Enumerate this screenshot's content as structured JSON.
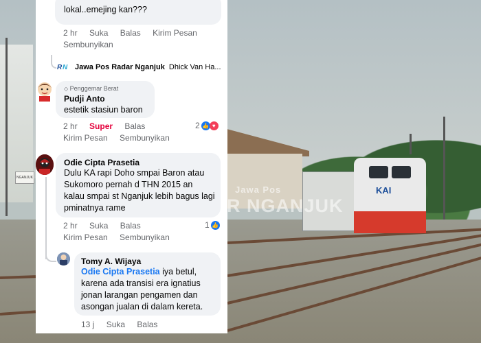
{
  "watermark": {
    "brand_small": "Jawa Pos",
    "brand": "R NGANJUK"
  },
  "station_sign": "NGANJUK",
  "train_logo": "KAI",
  "comments": {
    "top": {
      "text": "lokal..emejing kan???",
      "time": "2 hr",
      "like": "Suka",
      "reply": "Balas",
      "send": "Kirim Pesan",
      "hide": "Sembunyikan"
    },
    "reply_link": {
      "page_name": "Jawa Pos Radar Nganjuk",
      "preview": "Dhick Van Ha..."
    },
    "pudji": {
      "badge": "Penggemar Berat",
      "name": "Pudji Anto",
      "text": "estetik stasiun baron",
      "time": "2 hr",
      "super": "Super",
      "reply": "Balas",
      "send": "Kirim Pesan",
      "hide": "Sembunyikan",
      "reaction_count": "2"
    },
    "odie": {
      "name": "Odie Cipta Prasetia",
      "text": "Dulu KA rapi Doho smpai Baron atau Sukomoro pernah d THN 2015 an kalau smpai st Nganjuk lebih bagus lagi pminatnya rame",
      "time": "2 hr",
      "like": "Suka",
      "reply": "Balas",
      "send": "Kirim Pesan",
      "hide": "Sembunyikan",
      "reaction_count": "1"
    },
    "tomy": {
      "name": "Tomy A. Wijaya",
      "mention": "Odie Cipta Prasetia",
      "text": " iya betul, karena ada transisi era ignatius jonan larangan pengamen dan asongan jualan di dalam kereta.",
      "time": "13 j",
      "like": "Suka",
      "reply": "Balas"
    }
  },
  "colors": {
    "link": "#1877f2",
    "super": "#e4003b",
    "meta": "#65676b",
    "bubble": "#f0f2f5"
  }
}
